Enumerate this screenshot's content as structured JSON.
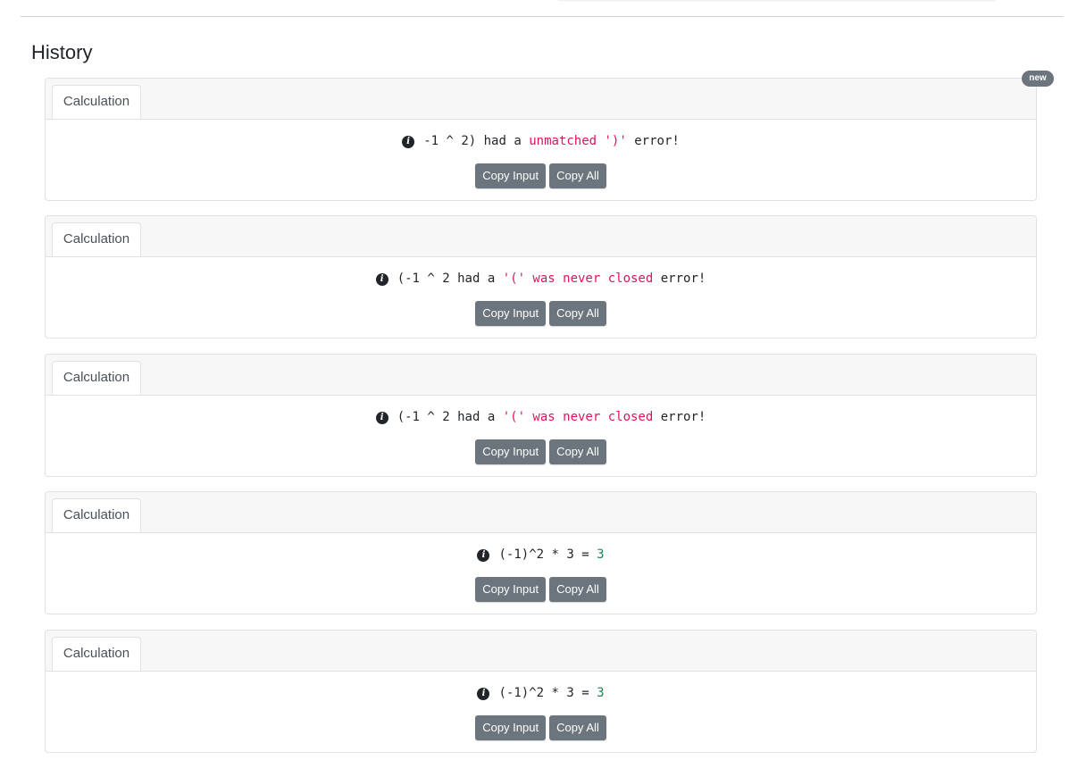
{
  "page": {
    "title": "History",
    "new_badge": "new"
  },
  "history": [
    {
      "tab_label": "Calculation",
      "info_icon": "info-circle-icon",
      "expression": "-1 ^ 2)",
      "connector": " had a ",
      "error": "unmatched ')'",
      "suffix": " error!",
      "copy_input": "Copy Input",
      "copy_all": "Copy All"
    },
    {
      "tab_label": "Calculation",
      "info_icon": "info-circle-icon",
      "expression": "(-1 ^ 2",
      "connector": " had a ",
      "error": "'(' was never closed",
      "suffix": " error!",
      "copy_input": "Copy Input",
      "copy_all": "Copy All"
    },
    {
      "tab_label": "Calculation",
      "info_icon": "info-circle-icon",
      "expression": "(-1 ^ 2",
      "connector": " had a ",
      "error": "'(' was never closed",
      "suffix": " error!",
      "copy_input": "Copy Input",
      "copy_all": "Copy All"
    },
    {
      "tab_label": "Calculation",
      "info_icon": "info-circle-icon",
      "expression": "(-1)^2 * 3",
      "equals": " = ",
      "result": "3",
      "copy_input": "Copy Input",
      "copy_all": "Copy All"
    },
    {
      "tab_label": "Calculation",
      "info_icon": "info-circle-icon",
      "expression": "(-1)^2 * 3",
      "equals": " = ",
      "result": "3",
      "copy_input": "Copy Input",
      "copy_all": "Copy All"
    }
  ],
  "colors": {
    "error_text": "#e0115f",
    "result_text": "#198754",
    "button_bg": "#6c757d",
    "badge_bg": "#6c757d"
  }
}
